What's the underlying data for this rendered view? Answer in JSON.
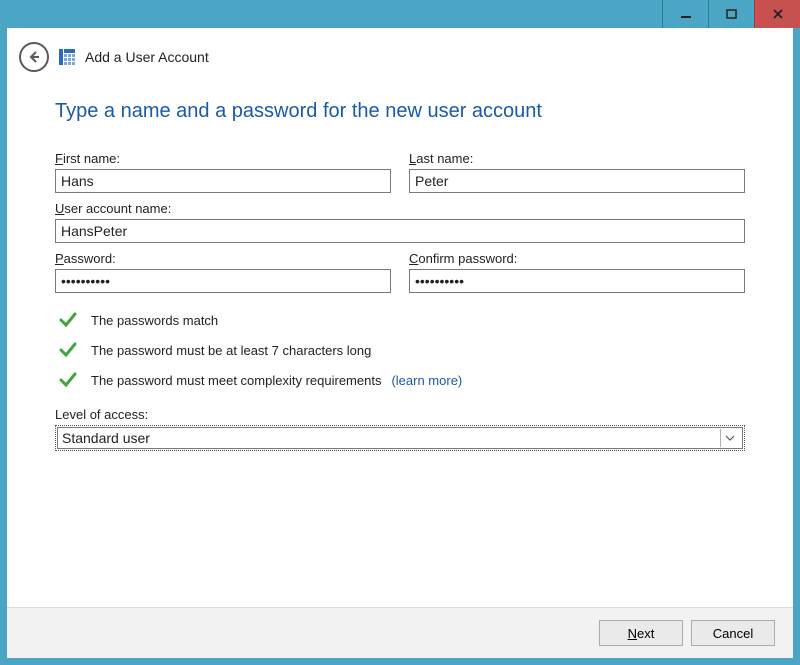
{
  "titlebar": {
    "minimize": "minimize",
    "maximize": "restore",
    "close": "close"
  },
  "header": {
    "title": "Add a User Account"
  },
  "page": {
    "heading": "Type a name and a password for the new user account",
    "labels": {
      "first_name": "First name:",
      "first_name_u": "F",
      "last_name": "Last name:",
      "last_name_u": "L",
      "account_name": "User account name:",
      "account_name_u": "U",
      "password": "Password:",
      "password_u": "P",
      "confirm": "Confirm password:",
      "confirm_u": "C",
      "level": "Level of access:"
    },
    "values": {
      "first_name": "Hans",
      "last_name": "Peter",
      "account_name": "HansPeter",
      "password": "••••••••••",
      "confirm": "••••••••••",
      "level": "Standard user"
    },
    "checks": [
      "The passwords match",
      "The password must be at least 7 characters long",
      "The password must meet complexity requirements"
    ],
    "learn_more": "(learn more)"
  },
  "footer": {
    "next": "Next",
    "next_u": "N",
    "cancel": "Cancel"
  }
}
